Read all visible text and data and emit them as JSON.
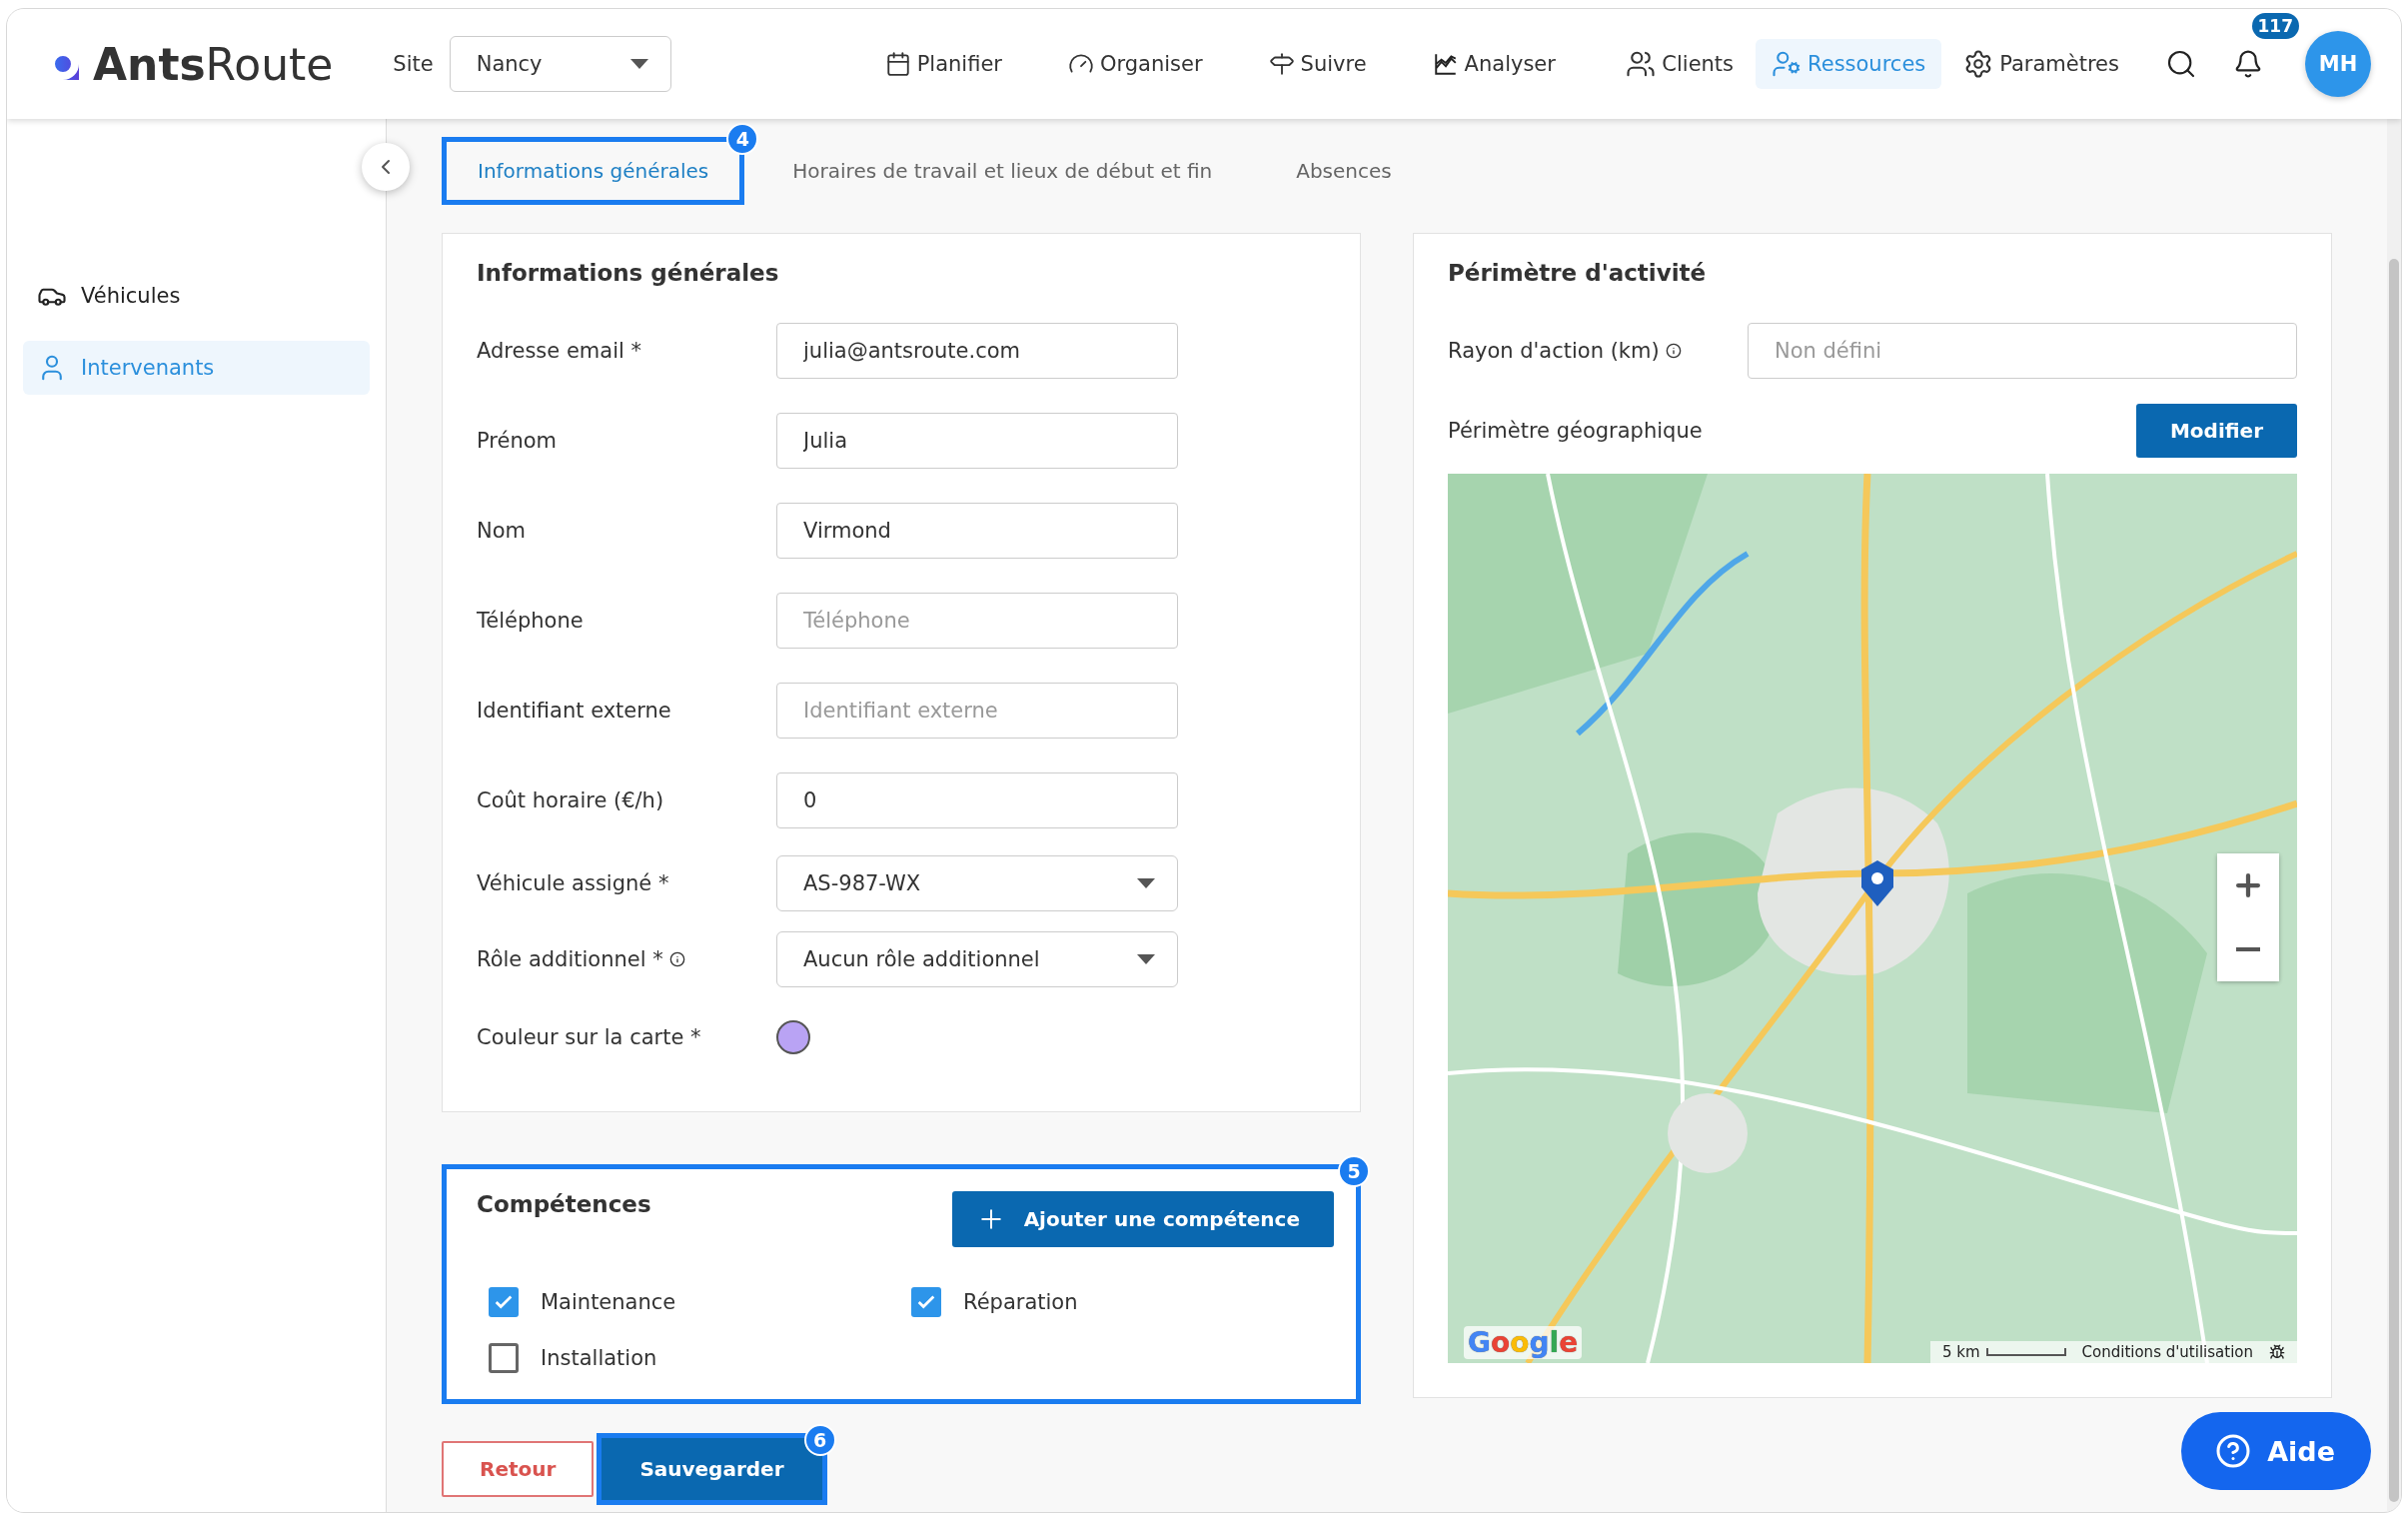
{
  "header": {
    "logo": {
      "bold": "Ants",
      "light": "Route"
    },
    "site_label": "Site",
    "site_value": "Nancy",
    "nav": [
      {
        "label": "Planifier"
      },
      {
        "label": "Organiser"
      },
      {
        "label": "Suivre"
      },
      {
        "label": "Analyser"
      }
    ],
    "right_nav": [
      {
        "label": "Clients",
        "selected": false
      },
      {
        "label": "Ressources",
        "selected": true
      },
      {
        "label": "Paramètres",
        "selected": false
      }
    ],
    "notifications": "117",
    "avatar": "MH"
  },
  "sidebar": {
    "items": [
      {
        "label": "Véhicules",
        "selected": false
      },
      {
        "label": "Intervenants",
        "selected": true
      }
    ]
  },
  "tabs": [
    {
      "label": "Informations générales",
      "selected": true,
      "callout": "4"
    },
    {
      "label": "Horaires de travail et lieux de début et fin",
      "selected": false
    },
    {
      "label": "Absences",
      "selected": false
    }
  ],
  "general": {
    "title": "Informations générales",
    "fields": [
      {
        "kind": "text",
        "label": "Adresse email *",
        "value": "julia@antsroute.com"
      },
      {
        "kind": "text",
        "label": "Prénom",
        "value": "Julia"
      },
      {
        "kind": "text",
        "label": "Nom",
        "value": "Virmond"
      },
      {
        "kind": "text",
        "label": "Téléphone",
        "placeholder": "Téléphone"
      },
      {
        "kind": "text",
        "label": "Identifiant externe",
        "placeholder": "Identifiant externe"
      },
      {
        "kind": "text",
        "label": "Coût horaire (€/h)",
        "value": "0"
      },
      {
        "kind": "select",
        "label": "Véhicule assigné *",
        "value": "AS-987-WX"
      },
      {
        "kind": "select",
        "label": "Rôle additionnel *",
        "info": true,
        "value": "Aucun rôle additionnel"
      },
      {
        "kind": "color",
        "label": "Couleur sur la carte *",
        "color": "#b9a3f4"
      }
    ]
  },
  "skills": {
    "title": "Compétences",
    "callout": "5",
    "add_button": "Ajouter une compétence",
    "items": [
      {
        "label": "Maintenance",
        "checked": true
      },
      {
        "label": "Réparation",
        "checked": true
      },
      {
        "label": "Installation",
        "checked": false
      }
    ]
  },
  "perimeter": {
    "title": "Périmètre d'activité",
    "radius_label": "Rayon d'action (km)",
    "radius_placeholder": "Non défini",
    "geo_label": "Périmètre géographique",
    "modify_button": "Modifier",
    "map": {
      "kind": "picture",
      "logo": "Google",
      "scale": "5 km",
      "terms": "Conditions d'utilisation"
    }
  },
  "actions": {
    "back": "Retour",
    "save": "Sauvegarder",
    "save_callout": "6"
  },
  "help_button": "Aide"
}
